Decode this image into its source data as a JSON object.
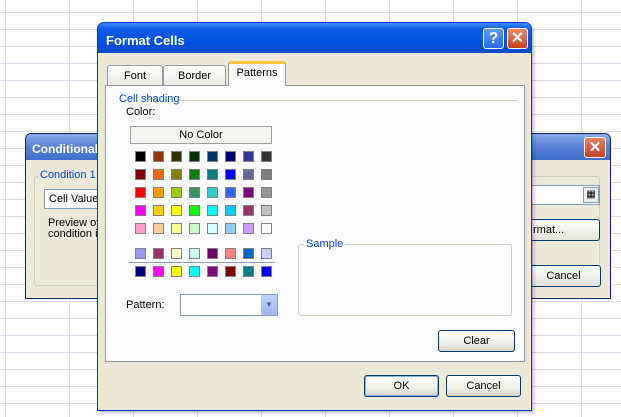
{
  "conditional_dialog": {
    "title": "Conditional",
    "close_glyph": "✕",
    "condition_label": "Condition 1",
    "cell_value": "Cell Value",
    "preview_text": "Preview of condition is",
    "format_button": "rmat...",
    "cancel_button": "Cancel",
    "palette_icon": "range-picker-icon"
  },
  "format_cells": {
    "title": "Format Cells",
    "help_glyph": "?",
    "close_glyph": "✕",
    "tabs": [
      {
        "label": "Font"
      },
      {
        "label": "Border"
      },
      {
        "label": "Patterns",
        "selected": true
      }
    ],
    "cell_shading_label": "Cell shading",
    "color_label": "Color:",
    "no_color_label": "No Color",
    "sample_label": "Sample",
    "pattern_label": "Pattern:",
    "pattern_value": "",
    "clear_button": "Clear",
    "ok_button": "OK",
    "cancel_button": "Cancel"
  },
  "palette": {
    "main_rows": [
      [
        "#000000",
        "#993300",
        "#333300",
        "#003300",
        "#003366",
        "#000080",
        "#333399",
        "#333333"
      ],
      [
        "#800000",
        "#ff6600",
        "#808000",
        "#008000",
        "#008080",
        "#0000ff",
        "#666699",
        "#808080"
      ],
      [
        "#ff0000",
        "#ff9900",
        "#99cc00",
        "#339966",
        "#33cccc",
        "#3366ff",
        "#800080",
        "#969696"
      ],
      [
        "#ff00ff",
        "#ffcc00",
        "#ffff00",
        "#00ff00",
        "#00ffff",
        "#00ccff",
        "#993366",
        "#c0c0c0"
      ],
      [
        "#ff99cc",
        "#ffcc99",
        "#ffff99",
        "#ccffcc",
        "#ccffff",
        "#99ccff",
        "#cc99ff",
        "#ffffff"
      ]
    ],
    "extra_rows": [
      [
        "#9999ff",
        "#993366",
        "#ffffcc",
        "#ccffff",
        "#660066",
        "#ff8080",
        "#0066cc",
        "#ccccff"
      ],
      [
        "#000080",
        "#ff00ff",
        "#ffff00",
        "#00ffff",
        "#800080",
        "#800000",
        "#008080",
        "#0000ff"
      ]
    ]
  }
}
